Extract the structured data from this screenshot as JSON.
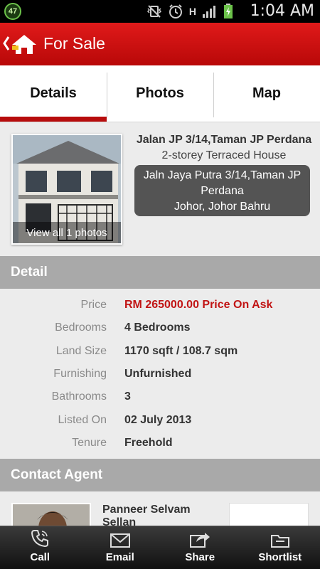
{
  "status_bar": {
    "badge": "47",
    "time": "1:04 AM",
    "network": "H"
  },
  "action_bar": {
    "title": "For Sale"
  },
  "tabs": [
    {
      "label": "Details",
      "active": true
    },
    {
      "label": "Photos",
      "active": false
    },
    {
      "label": "Map",
      "active": false
    }
  ],
  "listing": {
    "title": "Jalan JP 3/14,Taman JP Perdana",
    "type": "2-storey Terraced House",
    "address_line1": "Jaln Jaya Putra 3/14,Taman JP",
    "address_line2": "Perdana",
    "address_line3": "Johor, Johor Bahru",
    "photo_caption": "View all 1 photos"
  },
  "detail": {
    "header": "Detail",
    "rows": [
      {
        "label": "Price",
        "value": "RM 265000.00 Price On Ask"
      },
      {
        "label": "Bedrooms",
        "value": "4 Bedrooms"
      },
      {
        "label": "Land Size",
        "value": "1170 sqft / 108.7 sqm"
      },
      {
        "label": "Furnishing",
        "value": "Unfurnished"
      },
      {
        "label": "Bathrooms",
        "value": "3"
      },
      {
        "label": "Listed On",
        "value": "02 July 2013"
      },
      {
        "label": "Tenure",
        "value": "Freehold"
      }
    ]
  },
  "contact": {
    "header": "Contact Agent",
    "agent_name": "Panneer Selvam Sellan"
  },
  "bottom_bar": [
    {
      "label": "Call",
      "icon": "phone-icon"
    },
    {
      "label": "Email",
      "icon": "envelope-icon"
    },
    {
      "label": "Share",
      "icon": "share-icon"
    },
    {
      "label": "Shortlist",
      "icon": "folder-icon"
    }
  ],
  "colors": {
    "action_bar": "#c80d0d",
    "tab_indicator": "#b70d0d",
    "price": "#c11414",
    "section_header": "#a9a9a9"
  }
}
